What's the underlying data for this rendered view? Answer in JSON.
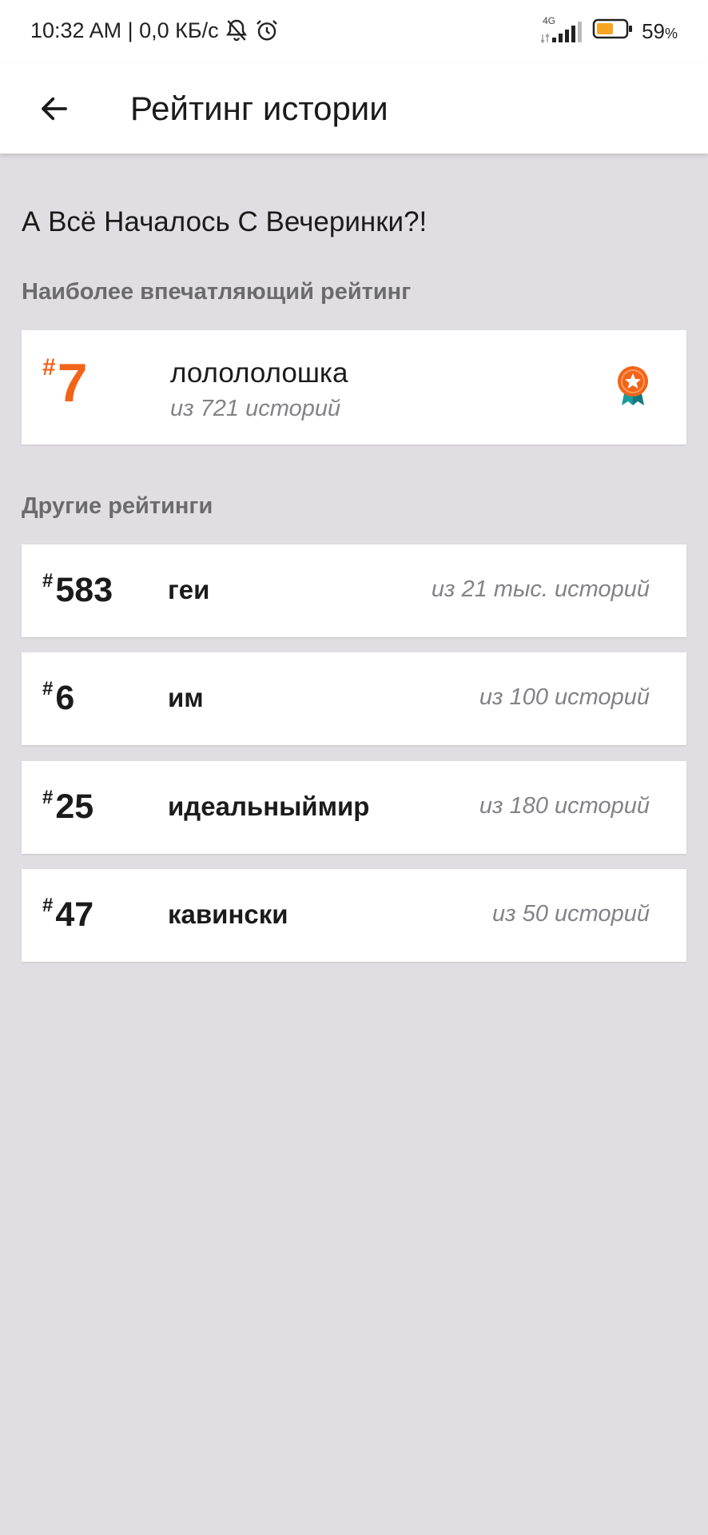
{
  "status_bar": {
    "time": "10:32 AM | 0,0 КБ/с",
    "network": "4G",
    "battery_percent": "59",
    "battery_unit": "%",
    "battery_level": 0.59,
    "icons": [
      "muted-bell-icon",
      "alarm-icon",
      "signal-icon",
      "battery-icon"
    ]
  },
  "app_bar": {
    "title": "Рейтинг истории",
    "back_icon": "arrow-back-icon"
  },
  "story": {
    "title": "А Всё Началось С Вечеринки?!"
  },
  "top_section": {
    "label": "Наиболее впечатляющий рейтинг",
    "item": {
      "hash": "#",
      "rank": "7",
      "tag": "лолололошка",
      "total": "из 721 историй",
      "icon": "medal-icon"
    }
  },
  "other_section": {
    "label": "Другие рейтинги",
    "items": [
      {
        "hash": "#",
        "rank": "583",
        "tag": "геи",
        "total": "из 21 тыс. историй"
      },
      {
        "hash": "#",
        "rank": "6",
        "tag": "им",
        "total": "из 100 историй"
      },
      {
        "hash": "#",
        "rank": "25",
        "tag": "идеальныймир",
        "total": "из 180 историй"
      },
      {
        "hash": "#",
        "rank": "47",
        "tag": "кавински",
        "total": "из 50 историй"
      }
    ]
  },
  "colors": {
    "accent": "#f26419",
    "medal_ribbon": "#1a9a9e",
    "background": "#e0dee2",
    "card": "#ffffff"
  }
}
